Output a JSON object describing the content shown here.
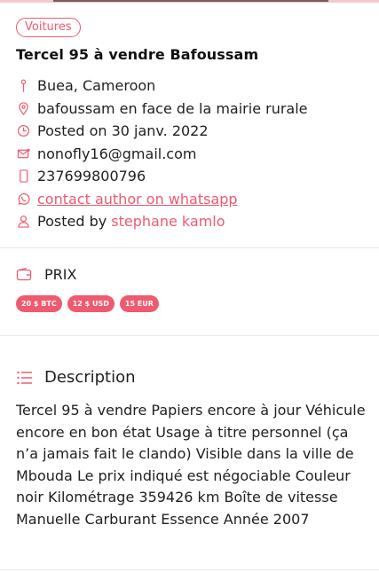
{
  "category_badge": "Voitures",
  "title": "Tercel 95 à vendre Bafoussam",
  "info": {
    "location": "Buea, Cameroon",
    "address": "bafoussam en face de la mairie rurale",
    "posted": "Posted on 30 janv. 2022",
    "email": "nonofly16@gmail.com",
    "phone": "237699800796",
    "whatsapp_link": "contact author on whatsapp",
    "posted_by_prefix": "Posted by ",
    "author": "stephane kamlo"
  },
  "prix": {
    "label": "PRIX",
    "prices": [
      "20 $ BTC",
      "12 $ USD",
      "15 EUR"
    ]
  },
  "description": {
    "heading": "Description",
    "text": "Tercel 95 à vendre Papiers encore à jour Véhicule encore en bon état Usage à titre personnel (ça n’a jamais fait le clando) Visible dans la ville de Mbouda Le prix indiqué est négociable Couleur noir Kilométrage 359426 km Boîte de vitesse Manuelle Carburant Essence Année 2007"
  },
  "colors": {
    "accent": "#ef5a6f",
    "text": "#1f1f1f",
    "separator": "#e8e8e8"
  },
  "icons": [
    "location-pin-icon",
    "map-marker-icon",
    "clock-icon",
    "mail-icon",
    "phone-icon",
    "whatsapp-icon",
    "user-icon",
    "wallet-icon",
    "list-icon"
  ]
}
